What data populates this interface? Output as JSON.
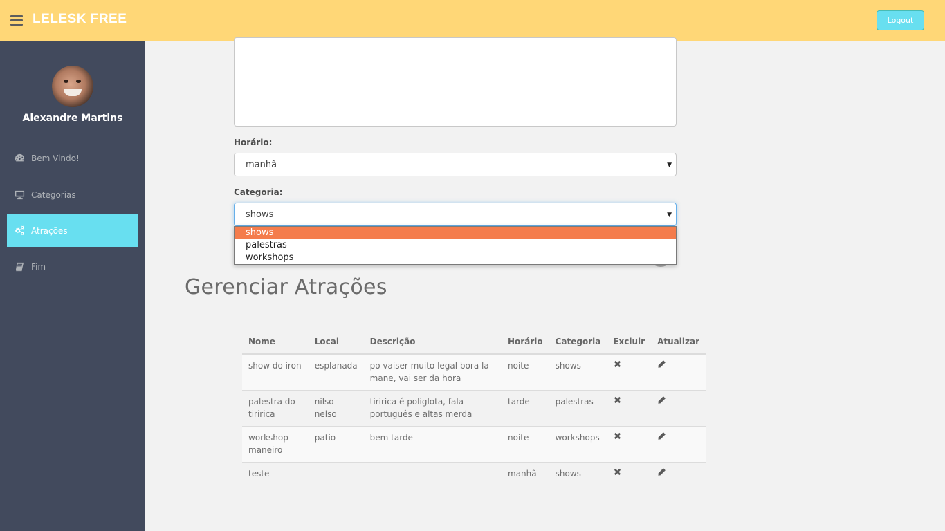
{
  "header": {
    "brand": "LELESK FREE",
    "logout_label": "Logout"
  },
  "sidebar": {
    "user_name": "Alexandre Martins",
    "items": [
      {
        "label": "Bem Vindo!",
        "icon": "dashboard-icon"
      },
      {
        "label": "Categorias",
        "icon": "desktop-icon"
      },
      {
        "label": "Atrações",
        "icon": "cogs-icon",
        "active": true
      },
      {
        "label": "Fim",
        "icon": "book-icon"
      }
    ]
  },
  "form": {
    "horario_label": "Horário:",
    "horario_value": "manhã",
    "categoria_label": "Categoria:",
    "categoria_value": "shows",
    "categoria_options": [
      "shows",
      "palestras",
      "workshops"
    ]
  },
  "page": {
    "title": "Gerenciar Atrações"
  },
  "table": {
    "headers": [
      "Nome",
      "Local",
      "Descrição",
      "Horário",
      "Categoria",
      "Excluir",
      "Atualizar"
    ],
    "rows": [
      {
        "nome": "show do iron",
        "local": "esplanada",
        "descricao": "po vaiser muito legal bora la mane, vai ser da hora",
        "horario": "noite",
        "categoria": "shows"
      },
      {
        "nome": "palestra do tiririca",
        "local": "nilso nelso",
        "descricao": "tiririca é poliglota, fala português e altas merda",
        "horario": "tarde",
        "categoria": "palestras"
      },
      {
        "nome": "workshop maneiro",
        "local": "patio",
        "descricao": "bem tarde",
        "horario": "noite",
        "categoria": "workshops"
      },
      {
        "nome": "teste",
        "local": "",
        "descricao": "",
        "horario": "manhã",
        "categoria": "shows"
      }
    ]
  },
  "colors": {
    "header_bg": "#ffd777",
    "sidebar_bg": "#424a5d",
    "accent": "#68dff0",
    "dropdown_highlight": "#f47c4c"
  }
}
